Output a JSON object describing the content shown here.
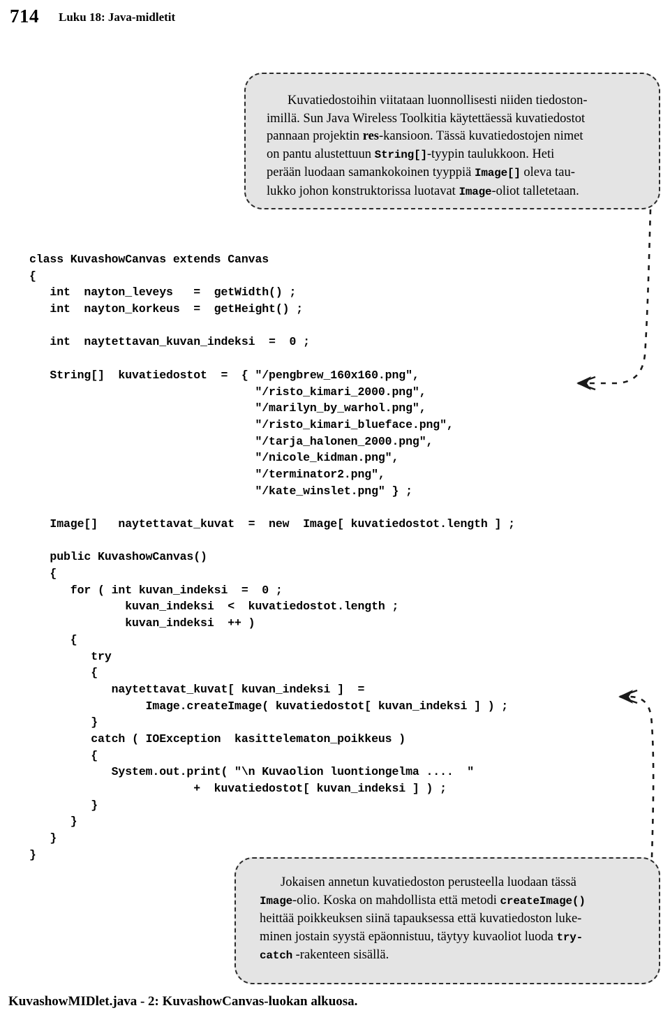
{
  "header": {
    "page_number": "714",
    "chapter_title": "Luku 18: Java-midletit"
  },
  "callout_top": {
    "line1": "Kuvatiedostoihin viitataan luonnollisesti niiden tiedoston-",
    "line2_a": "imillä. Sun Java Wireless Toolkitia käytettäessä kuvatiedostot",
    "line3_a": "pannaan projektin ",
    "line3_code": "res",
    "line3_b": "-kansioon. Tässä kuvatiedostojen nimet",
    "line4_a": "on pantu alustettuun ",
    "line4_code": "String[]",
    "line4_b": "-tyypin taulukkoon. Heti",
    "line5_a": "perään luodaan samankokoinen tyyppiä ",
    "line5_code": "Image[]",
    "line5_b": " oleva tau-",
    "line6_a": "lukko johon konstruktorissa luotavat ",
    "line6_code": "Image",
    "line6_b": "-oliot talletetaan."
  },
  "callout_bottom": {
    "line1": "Jokaisen annetun kuvatiedoston perusteella luodaan tässä",
    "line2_code": "Image",
    "line2_a": "-olio. Koska on mahdollista että metodi ",
    "line2_code2": "createImage()",
    "line3": "heittää poikkeuksen siinä tapauksessa että kuvatiedoston luke-",
    "line4_a": "minen jostain syystä epäonnistuu, täytyy kuvaoliot luoda ",
    "line4_code": "try-",
    "line5_code": "catch",
    "line5_a": " -rakenteen sisällä."
  },
  "code": {
    "lines": [
      "class KuvashowCanvas extends Canvas",
      "{",
      "   int  nayton_leveys   =  getWidth() ;",
      "   int  nayton_korkeus  =  getHeight() ;",
      "",
      "   int  naytettavan_kuvan_indeksi  =  0 ;",
      "",
      "   String[]  kuvatiedostot  =  { \"/pengbrew_160x160.png\",",
      "                                 \"/risto_kimari_2000.png\",",
      "                                 \"/marilyn_by_warhol.png\",",
      "                                 \"/risto_kimari_blueface.png\",",
      "                                 \"/tarja_halonen_2000.png\",",
      "                                 \"/nicole_kidman.png\",",
      "                                 \"/terminator2.png\",",
      "                                 \"/kate_winslet.png\" } ;",
      "",
      "   Image[]   naytettavat_kuvat  =  new  Image[ kuvatiedostot.length ] ;",
      "",
      "   public KuvashowCanvas()",
      "   {",
      "      for ( int kuvan_indeksi  =  0 ;",
      "              kuvan_indeksi  <  kuvatiedostot.length ;",
      "              kuvan_indeksi  ++ )",
      "      {",
      "         try",
      "         {",
      "            naytettavat_kuvat[ kuvan_indeksi ]  =",
      "                 Image.createImage( kuvatiedostot[ kuvan_indeksi ] ) ;",
      "         }",
      "         catch ( IOException  kasittelematon_poikkeus )",
      "         {",
      "            System.out.print( \"\\n Kuvaolion luontiongelma ....  \"",
      "                        +  kuvatiedostot[ kuvan_indeksi ] ) ;",
      "         }",
      "      }",
      "   }",
      "}"
    ]
  },
  "caption": {
    "text": "KuvashowMIDlet.java - 2:  KuvashowCanvas-luokan alkuosa."
  },
  "colors": {
    "callout_background": "#e4e4e4",
    "callout_border": "#2b2b2b",
    "text": "#000000",
    "page_background": "#ffffff"
  }
}
